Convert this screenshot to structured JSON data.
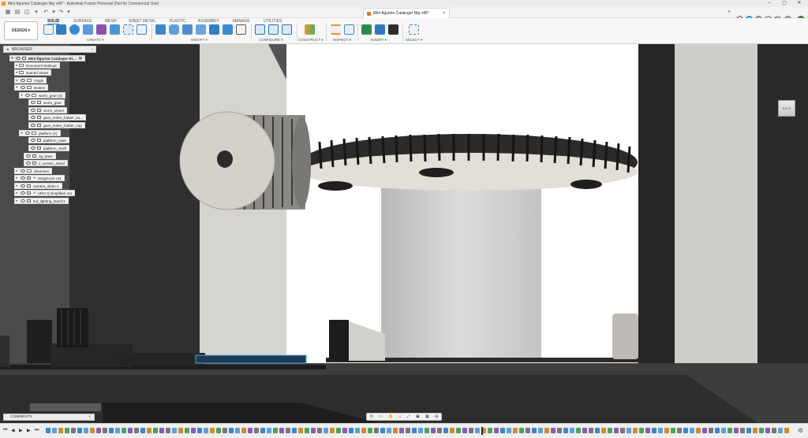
{
  "window": {
    "title": "Mini-figurine Cataloger Rig v46* - Autodesk Fusion Personal (Not for Commercial Use)",
    "controls": [
      "–",
      "▢",
      "✕"
    ]
  },
  "document_tab": {
    "label": "Mini-figurine Cataloger Rig v46*",
    "close": "✕"
  },
  "user_badge": "KA",
  "workspace": {
    "label": "DESIGN ▾"
  },
  "ribbon": {
    "tabs": [
      "SOLID",
      "SURFACE",
      "MESH",
      "SHEET METAL",
      "PLASTIC",
      "ASSEMBLY",
      "MANAGE",
      "UTILITIES"
    ],
    "active_tab": "SOLID",
    "groups": [
      "CREATE ▾",
      "MODIFY ▾",
      "CONFIGURE ▾",
      "CONSTRUCT ▾",
      "INSPECT ▾",
      "INSERT ▾",
      "SELECT ▾"
    ]
  },
  "browser": {
    "title": "BROWSER",
    "items": [
      {
        "label": "Mini-figurine Cataloger Ri...",
        "root": true
      },
      {
        "label": "Document Settings"
      },
      {
        "label": "Named Views"
      },
      {
        "label": "Origin"
      },
      {
        "label": "Bodies"
      },
      {
        "label": "worm_gear (4)"
      },
      {
        "label": "worm_gear"
      },
      {
        "label": "worm_wheel"
      },
      {
        "label": "gear_motor_holder_ba..."
      },
      {
        "label": "gear_motor_holder_cap"
      },
      {
        "label": "platform (2)"
      },
      {
        "label": "platform_main"
      },
      {
        "label": "platform_shaft"
      },
      {
        "label": "rig_base"
      },
      {
        "label": "ir_sensor_stand"
      },
      {
        "label": "Sketches"
      },
      {
        "label": "mmgm-pm v11"
      },
      {
        "label": "camera_slider:1"
      },
      {
        "label": "UNO Q simplified v11"
      },
      {
        "label": "led_lighting_stand:1"
      }
    ]
  },
  "viewcube": {
    "label": "BACK"
  },
  "comments": {
    "title": "COMMENTS",
    "add": "+"
  },
  "timeline": {
    "controls": [
      "⏮",
      "◀",
      "▶",
      "▶",
      "⏭"
    ]
  }
}
